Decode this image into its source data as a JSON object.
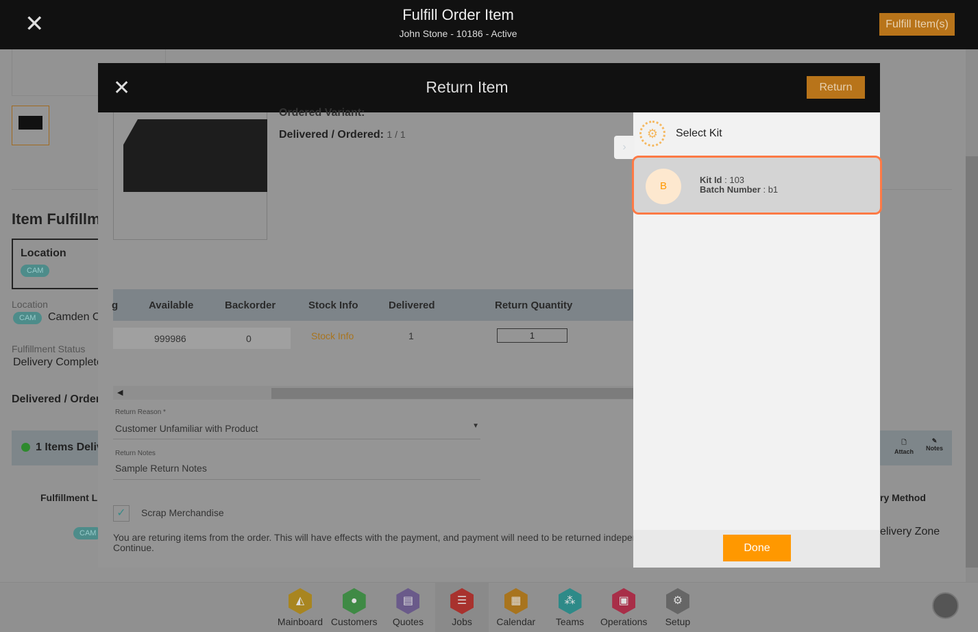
{
  "header": {
    "title": "Fulfill Order Item",
    "subtitle": "John Stone - 10186 - Active",
    "fulfill_button": "Fulfill Item(s)"
  },
  "background": {
    "section_title": "Item Fulfillm",
    "location_label": "Location",
    "location_badge": "CAM",
    "location_field_label": "Location",
    "location_badge2": "CAM",
    "location_value": "Camden C",
    "status_label": "Fulfillment Status",
    "status_value": "Delivery Complete",
    "delivered_label": "Delivered / Order",
    "items_banner": "1 Items Deliv",
    "attach": "Attach",
    "notes": "Notes",
    "fulfillment_l": "Fulfillment L",
    "badge3": "CAM",
    "delivery_method": "ry Method",
    "delivery_zone": "elivery Zone"
  },
  "modal": {
    "title": "Return Item",
    "return_button": "Return",
    "ordered_variant": "Ordered Variant:",
    "delivered_ordered_label": "Delivered / Ordered:",
    "delivered_ordered_value": "1 / 1",
    "table": {
      "headers": [
        "g",
        "Available",
        "Backorder",
        "Stock Info",
        "Delivered",
        "Return Quantity"
      ],
      "row": {
        "available": "999986",
        "backorder": "0",
        "stock_info": "Stock Info",
        "delivered": "1",
        "return_quantity": "1"
      }
    },
    "return_reason_label": "Return Reason *",
    "return_reason": "Customer Unfamiliar with Product",
    "return_notes_label": "Return Notes",
    "return_notes": "Sample Return Notes",
    "scrap_label": "Scrap Merchandise",
    "scrap_checked": true,
    "warning": "You are returing items from the order. This will have effects with the payment, and payment will need to be returned independen",
    "warning2": "Continue."
  },
  "kit_panel": {
    "title": "Select Kit",
    "kit": {
      "avatar": "B",
      "kit_id_label": "Kit Id",
      "kit_id": "103",
      "batch_label": "Batch Number",
      "batch": "b1"
    },
    "done": "Done"
  },
  "nav": [
    {
      "label": "Mainboard",
      "color": "#a88520"
    },
    {
      "label": "Customers",
      "color": "#3f8a45"
    },
    {
      "label": "Quotes",
      "color": "#6a5a8a"
    },
    {
      "label": "Jobs",
      "color": "#a8322e"
    },
    {
      "label": "Calendar",
      "color": "#a8741e"
    },
    {
      "label": "Teams",
      "color": "#2e8a88"
    },
    {
      "label": "Operations",
      "color": "#a82e48"
    },
    {
      "label": "Setup",
      "color": "#666666"
    }
  ]
}
